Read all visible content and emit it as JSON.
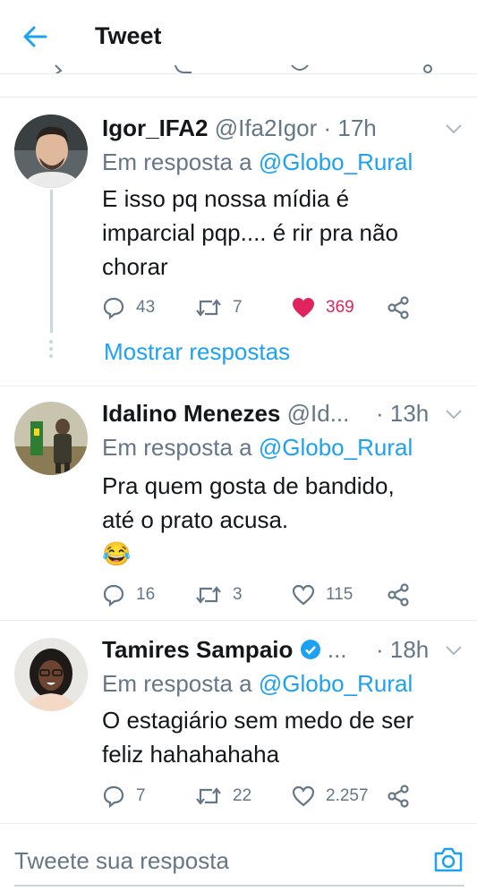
{
  "header": {
    "title": "Tweet",
    "back_icon": "arrow-left-icon",
    "accent": "#1da1f2"
  },
  "tweets": [
    {
      "name": "Igor_IFA2",
      "handle": "@Ifa2Igor",
      "dot": " · ",
      "time": "17h",
      "reply_prefix": "Em resposta a ",
      "reply_to": "@Globo_Rural",
      "text_lines": [
        "E isso pq nossa mídia é",
        "imparcial pqp.... é rir pra não",
        "chorar"
      ],
      "replies": "43",
      "retweets": "7",
      "likes": "369",
      "liked": true,
      "show_replies": "Mostrar respostas"
    },
    {
      "name": "Idalino Menezes",
      "handle": "@Id...",
      "dot": " · ",
      "time": "13h",
      "reply_prefix": "Em resposta a ",
      "reply_to": "@Globo_Rural",
      "text_lines": [
        "Pra quem gosta de bandido,",
        "até o prato acusa.",
        "😂"
      ],
      "replies": "16",
      "retweets": "3",
      "likes": "115",
      "liked": false
    },
    {
      "name": "Tamires Sampaio",
      "verified": true,
      "handle": "...",
      "dot": " · ",
      "time": "18h",
      "reply_prefix": "Em resposta a ",
      "reply_to": "@Globo_Rural",
      "text_lines": [
        "O estagiário sem medo de ser",
        "feliz hahahahaha"
      ],
      "replies": "7",
      "retweets": "22",
      "likes": "2.257",
      "liked": false
    }
  ],
  "compose": {
    "placeholder": "Tweete sua resposta",
    "camera_icon": "camera-icon"
  },
  "colors": {
    "link": "#1da1f2",
    "like": "#e0245e",
    "muted": "#657786",
    "divider": "#e6ecf0"
  }
}
